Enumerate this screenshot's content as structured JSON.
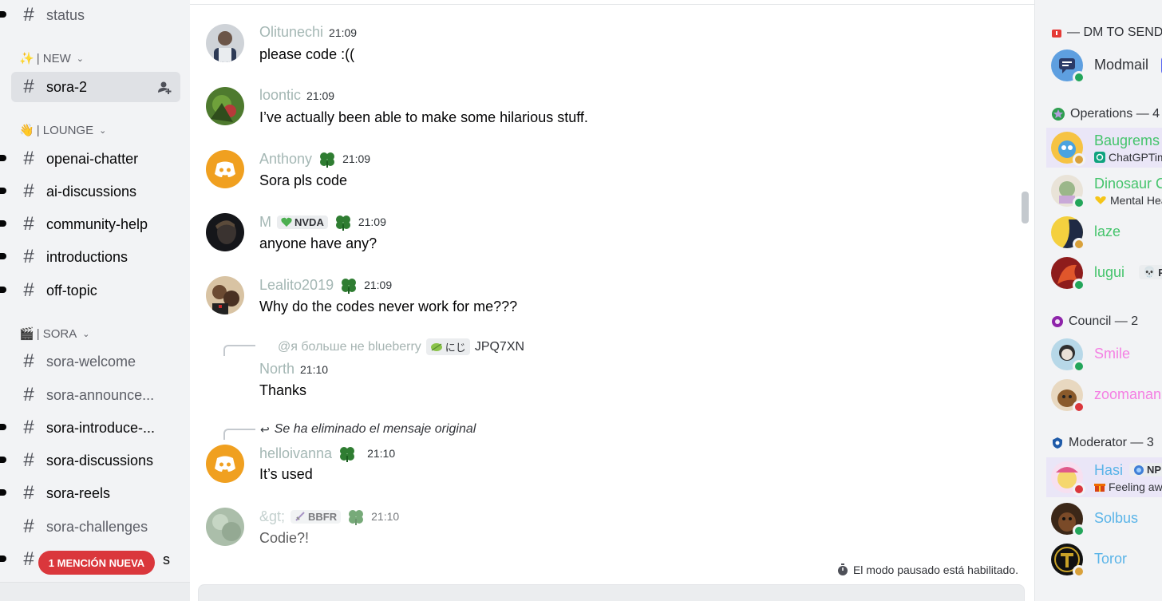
{
  "sidebar": {
    "channels_top": [
      {
        "label": "status"
      }
    ],
    "categories": {
      "new": {
        "emoji": "✨",
        "label": "| NEW"
      },
      "lounge": {
        "emoji": "👋",
        "label": "| LOUNGE"
      },
      "sora": {
        "emoji": "🎬",
        "label": "| SORA"
      }
    },
    "channel_active": {
      "label": "sora-2"
    },
    "lounge_channels": [
      {
        "label": "openai-chatter"
      },
      {
        "label": "ai-discussions"
      },
      {
        "label": "community-help"
      },
      {
        "label": "introductions"
      },
      {
        "label": "off-topic"
      }
    ],
    "sora_channels": [
      {
        "label": "sora-welcome"
      },
      {
        "label": "sora-announce..."
      },
      {
        "label": "sora-introduce-..."
      },
      {
        "label": "sora-discussions"
      },
      {
        "label": "sora-reels"
      },
      {
        "label": "sora-challenges"
      },
      {
        "label": "s"
      }
    ],
    "mention_pill": "1 MENCIÓN NUEVA"
  },
  "messages": [
    {
      "author": "Olitunechi",
      "time": "21:09",
      "text": "please code :(("
    },
    {
      "author": "loontic",
      "time": "21:09",
      "text": "I’ve actually been able to make some hilarious stuff."
    },
    {
      "author": "Anthony",
      "time": "21:09",
      "text": "Sora pls code"
    },
    {
      "author": "M",
      "tag": "NVDA",
      "time": "21:09",
      "text": "anyone have any?"
    },
    {
      "author": "Lealito2019",
      "time": "21:09",
      "text": "Why do the codes never work for me???"
    },
    {
      "author": "North",
      "time": "21:10",
      "text": "Thanks",
      "reply": {
        "mention": "@я больше не blueberry",
        "tag": "にじ",
        "snippet": "JPQ7XN"
      }
    },
    {
      "author": "helloivanna",
      "time": "21:10",
      "text": "It’s used",
      "reply": {
        "deleted_text": "Se ha eliminado el mensaje original"
      }
    },
    {
      "author": "&gt;",
      "tag": "BBFR",
      "time": "21:10",
      "text": "Codie?!"
    }
  ],
  "pause_note": "El modo pausado está habilitado.",
  "members": {
    "groups": [
      {
        "title": "— DM TO SEND ..."
      },
      {
        "title": "Operations — 4"
      },
      {
        "title": "Council — 2"
      },
      {
        "title": "Moderator — 3"
      }
    ],
    "modmail": {
      "name": "Modmail",
      "badge": "A"
    },
    "operations": [
      {
        "name": "Baugrems",
        "sub": "ChatGPTim"
      },
      {
        "name": "Dinosaur C",
        "sub": "Mental Hea"
      },
      {
        "name": "laze"
      },
      {
        "name": "lugui",
        "tag": "PA"
      }
    ],
    "council": [
      {
        "name": "Smile"
      },
      {
        "name": "zoomanan"
      }
    ],
    "moderators": [
      {
        "name": "Hasi",
        "tag": "NP",
        "sub": "Feeling aw"
      },
      {
        "name": "Solbus"
      },
      {
        "name": "Toror"
      }
    ]
  },
  "colors": {
    "accent_green": "#23a55a",
    "dnd_red": "#da373c",
    "idle_yellow": "#d9a13b",
    "discord_orange": "#f0a020",
    "operations_name": "#45c46c",
    "council_name": "#f47fe3",
    "moderator_name": "#5ab4e8",
    "author_muted": "#a4b7b4"
  }
}
